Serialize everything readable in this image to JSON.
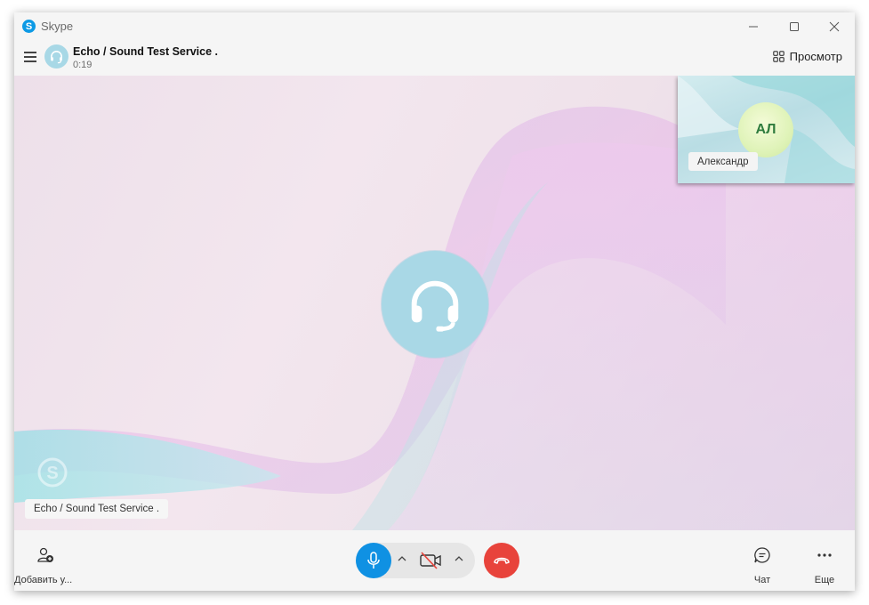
{
  "window": {
    "app_title": "Skype",
    "controls": [
      "minimize-icon",
      "maximize-icon",
      "close-icon"
    ]
  },
  "header": {
    "call_name": "Echo / Sound Test Service .",
    "timer": "0:19",
    "view_label": "Просмотр",
    "view_icon": "grid-icon"
  },
  "stage": {
    "remote_label": "Echo / Sound Test Service .",
    "remote_icon": "headset-icon",
    "self_initials": "АЛ",
    "self_label": "Александр"
  },
  "toolbar": {
    "add_user_label": "Добавить у...",
    "chat_label": "Чат",
    "more_label": "Еще"
  },
  "colors": {
    "accent": "#0f91e3",
    "hangup": "#e8433b",
    "avatar_bg": "#a9d8e6"
  }
}
